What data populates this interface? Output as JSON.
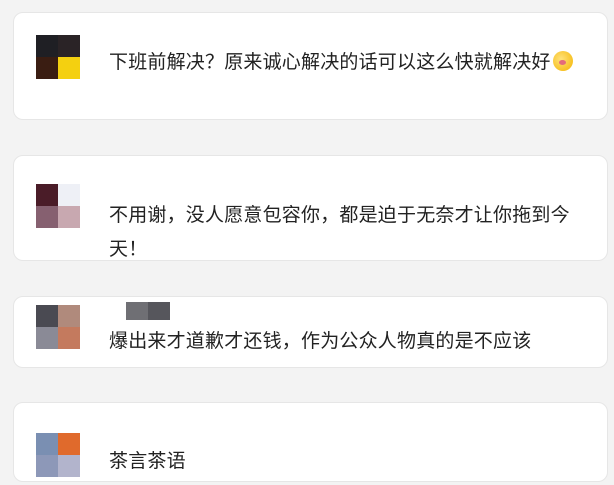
{
  "comments": [
    {
      "avatar_colors": [
        "#1f1f24",
        "#2a2326",
        "#3a1d12",
        "#f4d010"
      ],
      "text": "下班前解决？原来诚心解决的话可以这么快就解决好",
      "emoji": "face-savoring-food-emoji"
    },
    {
      "avatar_colors": [
        "#4a1c28",
        "#eef0f6",
        "#866070",
        "#c8a8b0"
      ],
      "text": "不用谢，没人愿意包容你，都是迫于无奈才让你拖到今天！"
    },
    {
      "avatar_colors": [
        "#4a4a52",
        "#b08a7c",
        "#8a8a96",
        "#c47a5e"
      ],
      "name_blur_colors": [
        "#6f6f74",
        "#56565c"
      ],
      "text": "爆出来才道歉才还钱，作为公众人物真的是不应该"
    },
    {
      "avatar_colors": [
        "#7a8fb2",
        "#e06a2c",
        "#8d98b8",
        "#b2b4cc"
      ],
      "text": "茶言茶语"
    }
  ]
}
